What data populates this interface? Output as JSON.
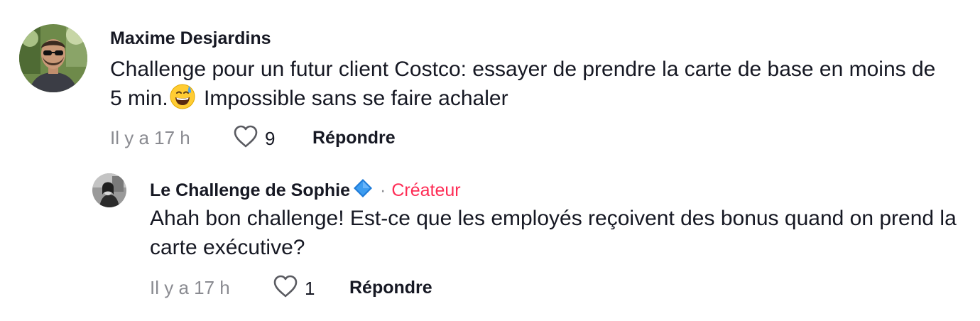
{
  "comments": [
    {
      "author": "Maxime Desjardins",
      "text_part1": "Challenge pour un futur client Costco: essayer de prendre la carte de base en moins de 5 min.",
      "emoji": "grinning-face-with-sweat",
      "text_part2": " Impossible sans se faire achaler",
      "time": "Il y a 17 h",
      "likes": "9",
      "reply_label": "Répondre"
    },
    {
      "author": "Le Challenge de Sophie",
      "verified_icon": "blue-diamond-icon",
      "separator": "·",
      "badge": "Créateur",
      "text": "Ahah bon challenge! Est-ce que les employés reçoivent des bonus quand on prend la carte exécutive?",
      "time": "Il y a 17 h",
      "likes": "1",
      "reply_label": "Répondre"
    }
  ],
  "colors": {
    "creator_badge": "#fe2c55",
    "meta_gray": "#8a8b91",
    "text": "#161823",
    "verified": "#1e7bd8"
  }
}
